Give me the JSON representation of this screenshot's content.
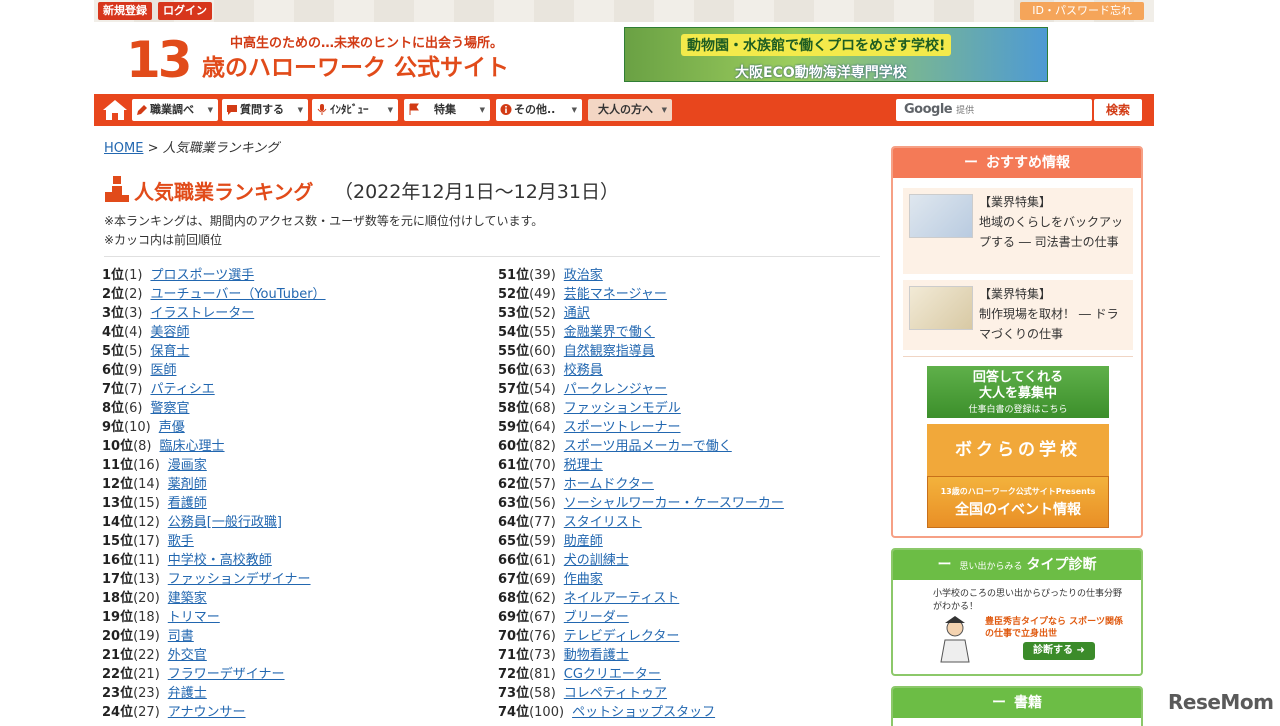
{
  "topbar": {
    "signup": "新規登録",
    "login": "ログイン",
    "forgot": "ID・パスワード忘れ"
  },
  "header": {
    "logo_number": "13",
    "logo_tagline": "中高生のための…未来のヒントに出会う場所。",
    "logo_main": "歳のハローワーク 公式サイト",
    "banner_line1": "動物園・水族館で働くプロをめざす学校!",
    "banner_line2": "大阪ECO動物海洋専門学校"
  },
  "nav": {
    "items": [
      {
        "label": "職業調べ"
      },
      {
        "label": "質問する"
      },
      {
        "label": "ｲﾝﾀﾋﾞｭｰ"
      },
      {
        "label": "特集"
      },
      {
        "label": "その他.."
      },
      {
        "label": "大人の方へ"
      }
    ],
    "search_logo": "Google",
    "search_sub": "提供",
    "search_button": "検索"
  },
  "breadcrumb": {
    "home": "HOME",
    "sep": ">",
    "current": "人気職業ランキング"
  },
  "ranking": {
    "title": "人気職業ランキング",
    "period": "（2022年12月1日～12月31日）",
    "note1": "※本ランキングは、期間内のアクセス数・ユーザ数等を元に順位付けしています。",
    "note2": "※カッコ内は前回順位",
    "left": [
      {
        "pos": "1位",
        "prev": "(1)",
        "name": "プロスポーツ選手"
      },
      {
        "pos": "2位",
        "prev": "(2)",
        "name": "ユーチューバー（YouTuber）"
      },
      {
        "pos": "3位",
        "prev": "(3)",
        "name": "イラストレーター"
      },
      {
        "pos": "4位",
        "prev": "(4)",
        "name": "美容師"
      },
      {
        "pos": "5位",
        "prev": "(5)",
        "name": "保育士"
      },
      {
        "pos": "6位",
        "prev": "(9)",
        "name": "医師"
      },
      {
        "pos": "7位",
        "prev": "(7)",
        "name": "パティシエ"
      },
      {
        "pos": "8位",
        "prev": "(6)",
        "name": "警察官"
      },
      {
        "pos": "9位",
        "prev": "(10)",
        "name": "声優"
      },
      {
        "pos": "10位",
        "prev": "(8)",
        "name": "臨床心理士"
      },
      {
        "pos": "11位",
        "prev": "(16)",
        "name": "漫画家"
      },
      {
        "pos": "12位",
        "prev": "(14)",
        "name": "薬剤師"
      },
      {
        "pos": "13位",
        "prev": "(15)",
        "name": "看護師"
      },
      {
        "pos": "14位",
        "prev": "(12)",
        "name": "公務員[一般行政職]"
      },
      {
        "pos": "15位",
        "prev": "(17)",
        "name": "歌手"
      },
      {
        "pos": "16位",
        "prev": "(11)",
        "name": "中学校・高校教師"
      },
      {
        "pos": "17位",
        "prev": "(13)",
        "name": "ファッションデザイナー"
      },
      {
        "pos": "18位",
        "prev": "(20)",
        "name": "建築家"
      },
      {
        "pos": "19位",
        "prev": "(18)",
        "name": "トリマー"
      },
      {
        "pos": "20位",
        "prev": "(19)",
        "name": "司書"
      },
      {
        "pos": "21位",
        "prev": "(22)",
        "name": "外交官"
      },
      {
        "pos": "22位",
        "prev": "(21)",
        "name": "フラワーデザイナー"
      },
      {
        "pos": "23位",
        "prev": "(23)",
        "name": "弁護士"
      },
      {
        "pos": "24位",
        "prev": "(27)",
        "name": "アナウンサー"
      }
    ],
    "right": [
      {
        "pos": "51位",
        "prev": "(39)",
        "name": "政治家"
      },
      {
        "pos": "52位",
        "prev": "(49)",
        "name": "芸能マネージャー"
      },
      {
        "pos": "53位",
        "prev": "(52)",
        "name": "通訳"
      },
      {
        "pos": "54位",
        "prev": "(55)",
        "name": "金融業界で働く"
      },
      {
        "pos": "55位",
        "prev": "(60)",
        "name": "自然観察指導員"
      },
      {
        "pos": "56位",
        "prev": "(63)",
        "name": "校務員"
      },
      {
        "pos": "57位",
        "prev": "(54)",
        "name": "パークレンジャー"
      },
      {
        "pos": "58位",
        "prev": "(68)",
        "name": "ファッションモデル"
      },
      {
        "pos": "59位",
        "prev": "(64)",
        "name": "スポーツトレーナー"
      },
      {
        "pos": "60位",
        "prev": "(82)",
        "name": "スポーツ用品メーカーで働く"
      },
      {
        "pos": "61位",
        "prev": "(70)",
        "name": "税理士"
      },
      {
        "pos": "62位",
        "prev": "(57)",
        "name": "ホームドクター"
      },
      {
        "pos": "63位",
        "prev": "(56)",
        "name": "ソーシャルワーカー・ケースワーカー"
      },
      {
        "pos": "64位",
        "prev": "(77)",
        "name": "スタイリスト"
      },
      {
        "pos": "65位",
        "prev": "(59)",
        "name": "助産師"
      },
      {
        "pos": "66位",
        "prev": "(61)",
        "name": "犬の訓練士"
      },
      {
        "pos": "67位",
        "prev": "(69)",
        "name": "作曲家"
      },
      {
        "pos": "68位",
        "prev": "(62)",
        "name": "ネイルアーティスト"
      },
      {
        "pos": "69位",
        "prev": "(67)",
        "name": "ブリーダー"
      },
      {
        "pos": "70位",
        "prev": "(76)",
        "name": "テレビディレクター"
      },
      {
        "pos": "71位",
        "prev": "(73)",
        "name": "動物看護士"
      },
      {
        "pos": "72位",
        "prev": "(81)",
        "name": "CGクリエーター"
      },
      {
        "pos": "73位",
        "prev": "(58)",
        "name": "コレペティトゥア"
      },
      {
        "pos": "74位",
        "prev": "(100)",
        "name": "ペットショップスタッフ"
      }
    ]
  },
  "sidebar": {
    "recommend_title": "おすすめ情報",
    "rec1_tag": "【業界特集】",
    "rec1_text": "地域のくらしをバックアップする ― 司法書士の仕事",
    "rec2_tag": "【業界特集】",
    "rec2_text": "制作現場を取材！ ― ドラマづくりの仕事",
    "banner1_line1": "回答してくれる",
    "banner1_line2": "大人を募集中",
    "banner1_small": "仕事白書の登録はこちら",
    "banner2": "ボクらの学校",
    "banner3_small": "13歳のハローワーク公式サイトPresents",
    "banner3": "全国のイベント情報",
    "type_title_small": "思い出からみる",
    "type_title": "タイプ診断",
    "type_desc": "小学校のころの思い出からぴったりの仕事分野がわかる！",
    "type_example": "豊臣秀吉タイプなら スポーツ関係の仕事で立身出世",
    "type_button": "診断する",
    "books_title": "書籍"
  },
  "watermark": "ReseMom",
  "colors": {
    "brand": "#e8461d",
    "link": "#2267b0",
    "recommend_head": "#f47a57",
    "type_head": "#6cbd45"
  }
}
